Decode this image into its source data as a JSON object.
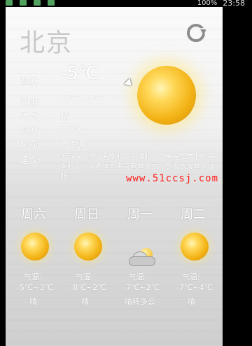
{
  "status": {
    "battery_text": "100%",
    "time": "23:58"
  },
  "app": {
    "city": "北京",
    "top_faint": "",
    "current": {
      "labels": [
        "温度:",
        "范围:",
        "天气:",
        "湿度:",
        "风向:",
        "建议:"
      ],
      "temperature": "-5℃",
      "range": "-8℃~4℃",
      "weather": "晴",
      "humidity": "36%",
      "wind": "西南风",
      "advice": "天气冷，建议着棉服、羽绒服、皮夹克加羊毛衫等冬季服装。年老体弱者宜着厚棉衣、冬大衣或厚羽绒服。"
    },
    "forecast": [
      {
        "day": "周六",
        "label": "气温:",
        "range": "-5℃~3℃",
        "weather": "晴",
        "icon": "sun-icon"
      },
      {
        "day": "周日",
        "label": "气温:",
        "range": "-8℃~2℃",
        "weather": "晴",
        "icon": "sun-icon"
      },
      {
        "day": "周一",
        "label": "气温:",
        "range": "-7℃~2℃",
        "weather": "晴转多云",
        "icon": "partly-cloudy-icon"
      },
      {
        "day": "周二",
        "label": "气温:",
        "range": "-7℃~4℃",
        "weather": "晴",
        "icon": "sun-icon"
      }
    ]
  },
  "watermark": "www.51ccsj.com",
  "colors": {
    "label": "#ffffff",
    "city": "#c9c9c9",
    "watermark": "#ff1b1b",
    "sun": "#f3b417"
  }
}
